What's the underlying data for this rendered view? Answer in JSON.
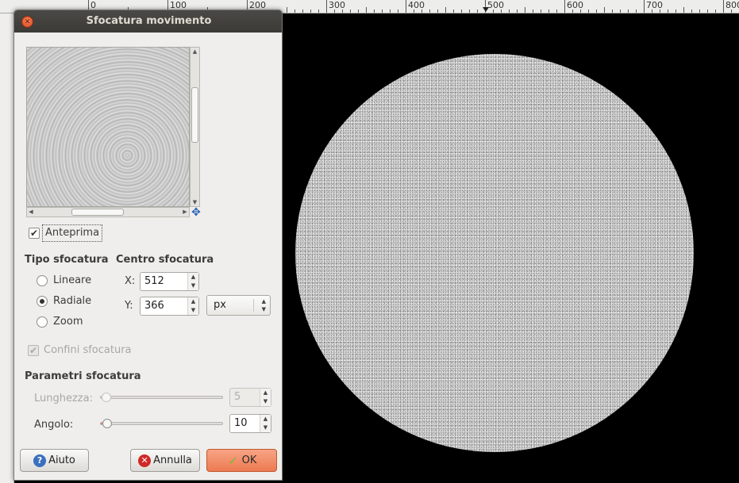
{
  "ruler": {
    "labels": [
      "0",
      "100",
      "200",
      "300",
      "400",
      "500",
      "600",
      "700",
      "800"
    ]
  },
  "dialog": {
    "title": "Sfocatura movimento",
    "preview_label": "Anteprima",
    "preview_checked": true,
    "blur_type": {
      "heading": "Tipo sfocatura",
      "options": [
        "Lineare",
        "Radiale",
        "Zoom"
      ],
      "selected": "Radiale"
    },
    "blur_center": {
      "heading": "Centro sfocatura",
      "x_label": "X:",
      "x_value": "512",
      "y_label": "Y:",
      "y_value": "366",
      "unit": "px"
    },
    "blur_outline": {
      "label": "Confini sfocatura",
      "checked": true,
      "enabled": false
    },
    "parameters": {
      "heading": "Parametri sfocatura",
      "length_label": "Lunghezza:",
      "length_value": "5",
      "angle_label": "Angolo:",
      "angle_value": "10"
    },
    "buttons": {
      "help": "Aiuto",
      "cancel": "Annulla",
      "ok": "OK"
    }
  },
  "colors": {
    "ok_button": "#ec7a52",
    "titlebar": "#3c3b37",
    "close_button": "#e9582c",
    "canvas_bg": "#000000"
  }
}
